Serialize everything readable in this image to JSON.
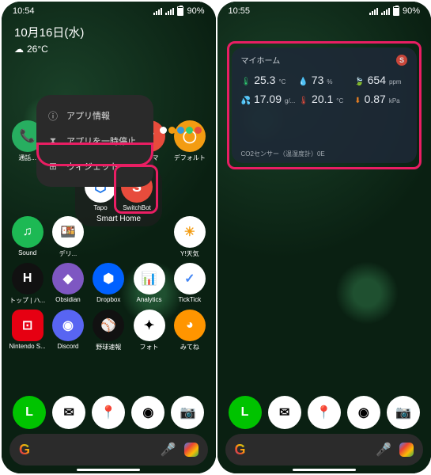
{
  "status": {
    "time1": "10:54",
    "time2": "10:55",
    "battery": "90%"
  },
  "date": "10月16日(水)",
  "temp": "26°C",
  "menu": {
    "info": "アプリ情報",
    "pause": "アプリを一時停止",
    "widget": "ウィジェット"
  },
  "folder": {
    "name": "Smart Home",
    "tapo": "Tapo",
    "switchbot": "SwitchBot"
  },
  "apps": {
    "r1c1": "通話...",
    "r1c4": "フリマ",
    "r1c5": "デフォルト",
    "r3c1": "Sound",
    "r3c2": "デリ...",
    "r3c5": "Y!天気",
    "r4c1": "トップ | ハ...",
    "r4c2": "Obsidian",
    "r4c3": "Dropbox",
    "r4c4": "Analytics",
    "r4c5": "TickTick",
    "r5c1": "Nintendo S...",
    "r5c2": "Discord",
    "r5c3": "野球速報",
    "r5c4": "フォト",
    "r5c5": "みてね"
  },
  "widget": {
    "title": "マイホーム",
    "temp_v": "25.3",
    "temp_u": "°C",
    "hum_v": "73",
    "hum_u": "%",
    "co2_v": "654",
    "co2_u": "ppm",
    "abs_v": "17.09",
    "abs_u": "g/...",
    "dew_v": "20.1",
    "dew_u": "°C",
    "press_v": "0.87",
    "press_u": "kPa",
    "footer": "CO2センサー（温湿度計）0E"
  }
}
